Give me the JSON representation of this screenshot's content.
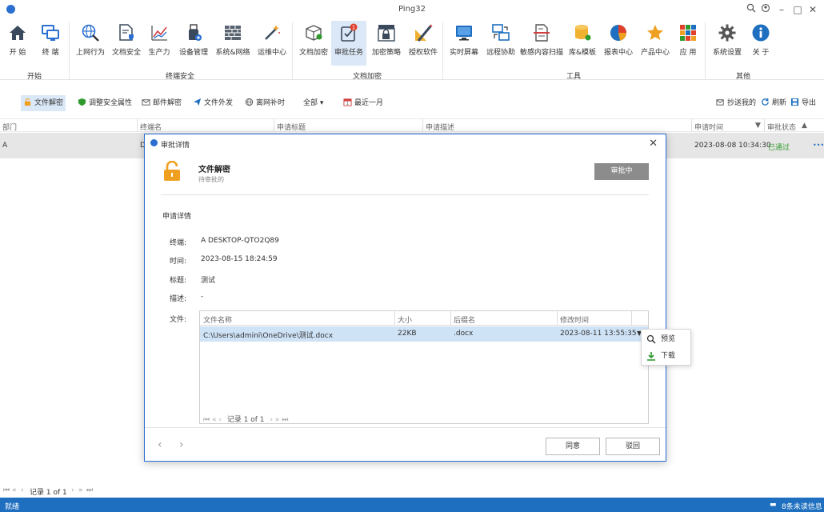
{
  "window": {
    "title": "Ping32"
  },
  "ribbon": {
    "items": [
      {
        "label": "开 始",
        "icon": "home-icon"
      },
      {
        "label": "终 端",
        "icon": "terminal-icon"
      },
      {
        "label": "上网行为",
        "icon": "globe-search-icon"
      },
      {
        "label": "文档安全",
        "icon": "doc-shield-icon"
      },
      {
        "label": "生产力",
        "icon": "productivity-chart-icon"
      },
      {
        "label": "设备管理",
        "icon": "usb-device-icon"
      },
      {
        "label": "系统&网络",
        "icon": "firewall-icon"
      },
      {
        "label": "运维中心",
        "icon": "magic-wand-icon"
      },
      {
        "label": "文档加密",
        "icon": "box-encrypt-icon"
      },
      {
        "label": "审批任务",
        "icon": "approval-task-icon",
        "badge": "1",
        "active": true
      },
      {
        "label": "加密策略",
        "icon": "lock-policy-icon"
      },
      {
        "label": "授权软件",
        "icon": "ruler-pencil-icon"
      },
      {
        "label": "实时屏幕",
        "icon": "monitor-icon"
      },
      {
        "label": "远程协助",
        "icon": "remote-screens-icon"
      },
      {
        "label": "敏感内容扫描",
        "icon": "scan-doc-icon"
      },
      {
        "label": "库&模板",
        "icon": "database-icon"
      },
      {
        "label": "报表中心",
        "icon": "pie-chart-icon"
      },
      {
        "label": "产品中心",
        "icon": "star-icon"
      },
      {
        "label": "应 用",
        "icon": "apps-grid-icon"
      },
      {
        "label": "系统设置",
        "icon": "gear-icon"
      },
      {
        "label": "关 于",
        "icon": "info-icon"
      }
    ],
    "groups": [
      "开始",
      "终端安全",
      "文档加密",
      "工具",
      "其他"
    ]
  },
  "toolbar": {
    "file_decrypt": "文件解密",
    "adjust_security": "调整安全属性",
    "mail_decrypt": "邮件解密",
    "file_outgoing": "文件外发",
    "offline_extend": "离网补时",
    "filter_all": "全部",
    "recent_month": "最近一月",
    "cc_me": "抄送我的",
    "refresh": "刷新",
    "export": "导出"
  },
  "grid": {
    "headers": [
      "部门",
      "终端名",
      "申请标题",
      "申请描述",
      "申请时间",
      "审批状态"
    ],
    "row": {
      "dept": "A",
      "terminal": "D",
      "time": "2023-08-08 10:34:30",
      "status": "已通过",
      "more": "•••"
    },
    "footer": "记录 1 of 1"
  },
  "dialog": {
    "title": "审批详情",
    "header_title": "文件解密",
    "header_sub": "待审批的",
    "status_button": "审批中",
    "section": "申请详情",
    "labels": {
      "terminal": "终端:",
      "time": "时间:",
      "subject": "标题:",
      "desc": "描述:",
      "files": "文件:"
    },
    "values": {
      "terminal": "A DESKTOP-QTO2Q89",
      "time": "2023-08-15 18:24:59",
      "subject": "测试",
      "desc": "-"
    },
    "file_table": {
      "headers": [
        "文件名称",
        "大小",
        "后缀名",
        "修改时间"
      ],
      "rows": [
        {
          "name": "C:\\Users\\admini\\OneDrive\\测试.docx",
          "size": "22KB",
          "ext": ".docx",
          "mtime": "2023-08-11 13:55:35"
        }
      ],
      "footer": "记录 1 of 1"
    },
    "buttons": {
      "approve": "同意",
      "reject": "驳回"
    }
  },
  "context_menu": {
    "preview": "预览",
    "download": "下载"
  },
  "statusbar": {
    "left": "就绪",
    "right": "8条未读信息"
  },
  "colors": {
    "accent": "#1e6fbf",
    "approved": "#2e9a2e",
    "pending": "#8c8c8c"
  }
}
